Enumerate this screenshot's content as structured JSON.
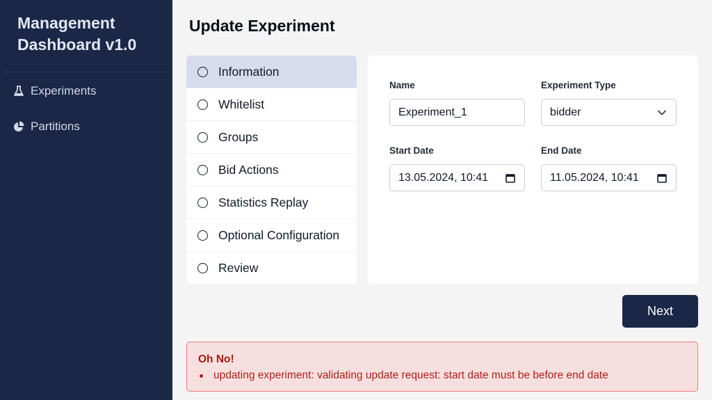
{
  "sidebar": {
    "brand": "Management Dashboard v1.0",
    "items": [
      {
        "label": "Experiments",
        "icon": "flask-icon"
      },
      {
        "label": "Partitions",
        "icon": "pie-chart-icon"
      }
    ]
  },
  "page": {
    "title": "Update Experiment"
  },
  "steps": [
    {
      "label": "Information",
      "active": true
    },
    {
      "label": "Whitelist"
    },
    {
      "label": "Groups"
    },
    {
      "label": "Bid Actions"
    },
    {
      "label": "Statistics Replay"
    },
    {
      "label": "Optional Configuration"
    },
    {
      "label": "Review"
    }
  ],
  "form": {
    "name_label": "Name",
    "name_value": "Experiment_1",
    "type_label": "Experiment Type",
    "type_value": "bidder",
    "start_label": "Start Date",
    "start_value": "13.05.2024, 10:41",
    "end_label": "End Date",
    "end_value": "11.05.2024, 10:41"
  },
  "actions": {
    "next_label": "Next"
  },
  "alert": {
    "title": "Oh No!",
    "message": "updating experiment: validating update request: start date must be before end date"
  },
  "colors": {
    "sidebar_bg": "#1a2747",
    "active_step_bg": "#d7dcec",
    "alert_bg": "#f8dfdf",
    "alert_border": "#ea7f7a",
    "alert_text": "#b11f16"
  }
}
